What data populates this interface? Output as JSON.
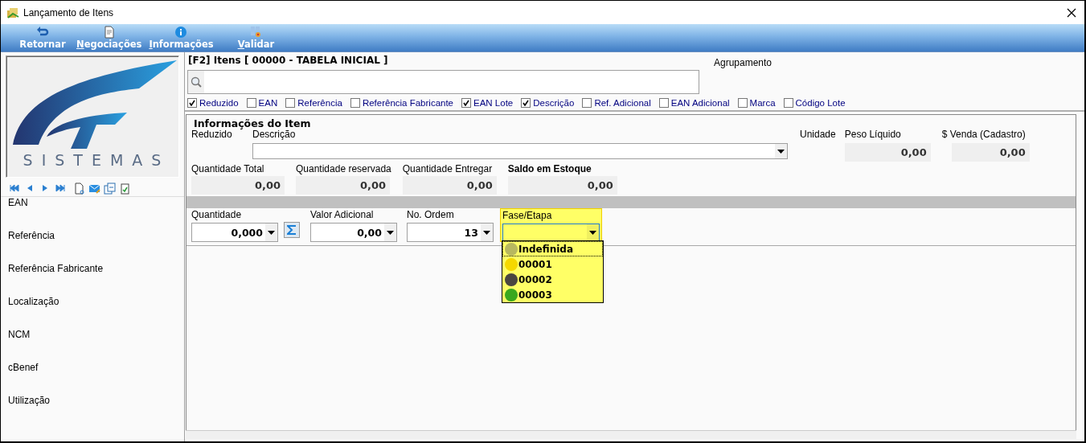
{
  "window": {
    "title": "Lançamento de Itens"
  },
  "toolbar": {
    "buttons": [
      {
        "kind": "return",
        "label": "Retornar",
        "access_key_underlined": false
      },
      {
        "kind": "document",
        "label": "Negociações",
        "access_key_underlined": true
      },
      {
        "kind": "info",
        "label": "Informações",
        "access_key_underlined": true
      },
      {
        "kind": "validate",
        "label": "Validar",
        "access_key_underlined": true
      }
    ]
  },
  "logo": {
    "text": "SISTEMAS"
  },
  "sidebar": {
    "items": [
      "EAN",
      "Referência",
      "Referência Fabricante",
      "Localização",
      "NCM",
      "cBenef",
      "Utilização"
    ]
  },
  "search": {
    "title": "[F2] Itens [ 00000 - TABELA INICIAL ]",
    "group_label": "Agrupamento",
    "filters": [
      {
        "label": "Reduzido",
        "checked": true
      },
      {
        "label": "EAN",
        "checked": false
      },
      {
        "label": "Referência",
        "checked": false
      },
      {
        "label": "Referência Fabricante",
        "checked": false
      },
      {
        "label": "EAN Lote",
        "checked": true
      },
      {
        "label": "Descrição",
        "checked": true
      },
      {
        "label": "Ref. Adicional",
        "checked": false
      },
      {
        "label": "EAN Adicional",
        "checked": false
      },
      {
        "label": "Marca",
        "checked": false
      },
      {
        "label": "Código Lote",
        "checked": false
      }
    ]
  },
  "item_info": {
    "title": "Informações do Item",
    "reduzido_label": "Reduzido",
    "descricao_label": "Descrição",
    "unidade_label": "Unidade",
    "peso": {
      "label": "Peso Líquido",
      "value": "0,00"
    },
    "venda": {
      "label": "$ Venda (Cadastro)",
      "value": "0,00"
    },
    "stats": [
      {
        "label": "Quantidade Total",
        "value": "0,00",
        "bold": false
      },
      {
        "label": "Quantidade reservada",
        "value": "0,00",
        "bold": false
      },
      {
        "label": "Quantidade Entregar",
        "value": "0,00",
        "bold": false
      },
      {
        "label": "Saldo em Estoque",
        "value": "0,00",
        "bold": true
      }
    ],
    "quantidade": {
      "label": "Quantidade",
      "value": "0,000"
    },
    "valor_adicional": {
      "label": "Valor Adicional",
      "value": "0,00"
    },
    "no_ordem": {
      "label": "No. Ordem",
      "value": "13"
    },
    "fase": {
      "label": "Fase/Etapa",
      "expanded": true,
      "options": [
        {
          "label": "Indefinida",
          "color": "#b8b860",
          "selected": true
        },
        {
          "label": "00001",
          "color": "#f5d800",
          "selected": false
        },
        {
          "label": "00002",
          "color": "#4a4640",
          "selected": false
        },
        {
          "label": "00003",
          "color": "#3aa81e",
          "selected": false
        }
      ]
    }
  }
}
